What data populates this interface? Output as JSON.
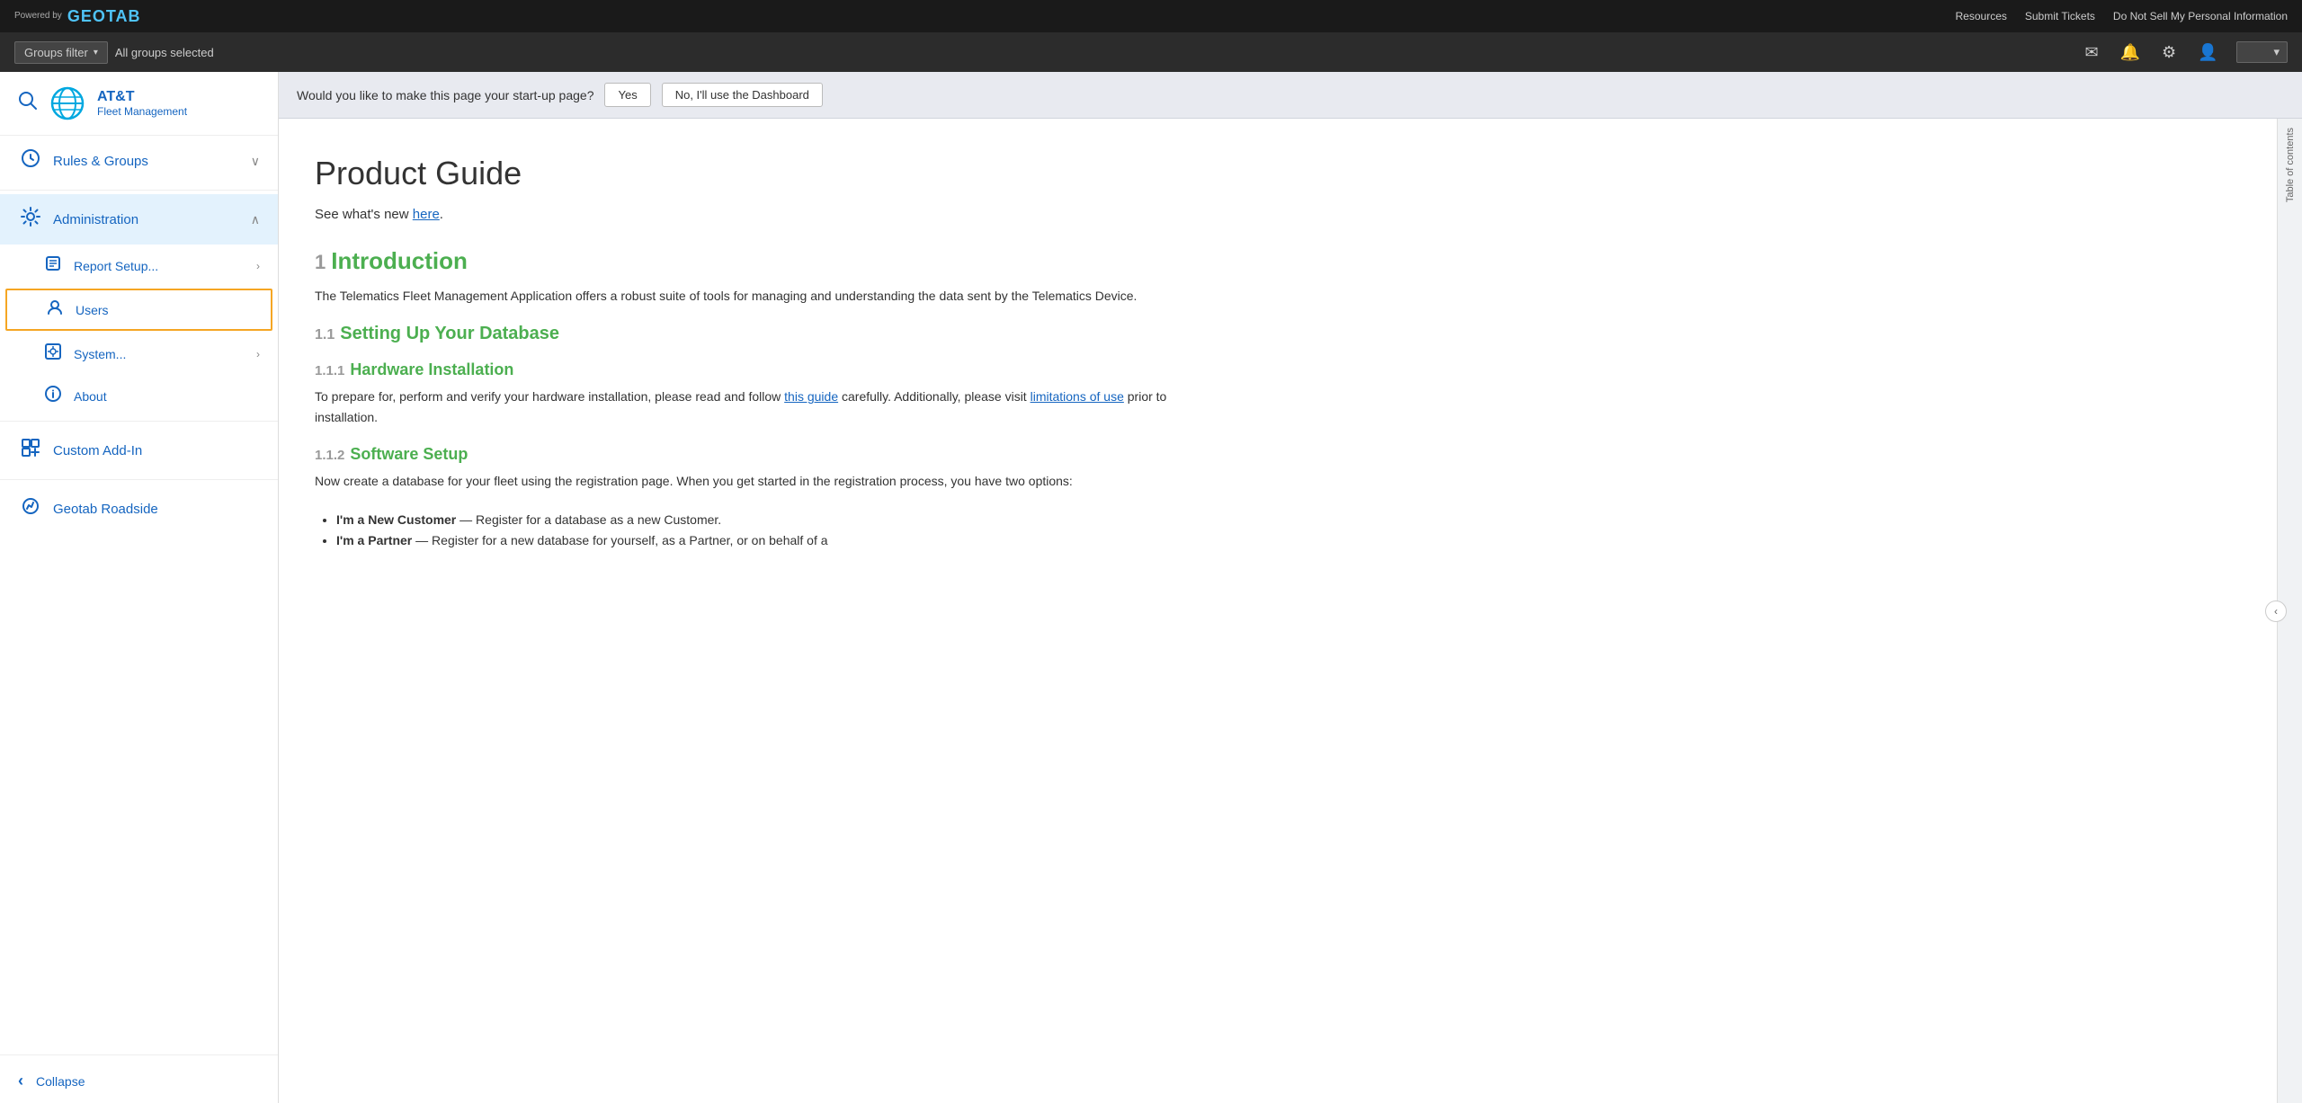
{
  "topbar": {
    "powered_by": "Powered\nby",
    "logo": "GEOTAB",
    "links": [
      "Resources",
      "Submit Tickets",
      "Do Not Sell My Personal Information"
    ]
  },
  "secondbar": {
    "groups_filter_label": "Groups filter",
    "groups_filter_arrow": "▾",
    "all_groups_text": "All groups selected",
    "icons": {
      "mail": "✉",
      "bell": "🔔",
      "gear": "⚙",
      "user": "👤"
    },
    "user_menu_arrow": "▾"
  },
  "sidebar": {
    "search_icon": "🔍",
    "brand_name": "AT&T",
    "brand_sub": "Fleet Management",
    "nav_items": [
      {
        "id": "rules-groups",
        "label": "Rules & Groups",
        "icon": "gear",
        "expandable": true,
        "expanded": false
      },
      {
        "id": "administration",
        "label": "Administration",
        "icon": "settings",
        "expandable": true,
        "expanded": true,
        "sub_items": [
          {
            "id": "report-setup",
            "label": "Report Setup...",
            "icon": "report",
            "has_arrow": true
          },
          {
            "id": "users",
            "label": "Users",
            "icon": "user",
            "selected": true
          },
          {
            "id": "system",
            "label": "System...",
            "icon": "system",
            "has_arrow": true
          },
          {
            "id": "about",
            "label": "About",
            "icon": "info"
          }
        ]
      },
      {
        "id": "custom-add-in",
        "label": "Custom Add-In",
        "icon": "puzzle"
      },
      {
        "id": "geotab-roadside",
        "label": "Geotab Roadside",
        "icon": "roadside"
      }
    ],
    "collapse_label": "Collapse",
    "collapse_icon": "‹"
  },
  "startup_bar": {
    "question": "Would you like to make this page your start-up page?",
    "yes_label": "Yes",
    "no_label": "No, I'll use the Dashboard"
  },
  "doc": {
    "title": "Product Guide",
    "subtitle_prefix": "See what's new ",
    "subtitle_link": "here",
    "subtitle_suffix": ".",
    "sections": [
      {
        "num": "1",
        "title": "Introduction",
        "body": "The Telematics Fleet Management Application offers a robust suite of tools for managing and understanding the data sent by the Telematics Device.",
        "subsections": [
          {
            "num": "1.1",
            "title": "Setting Up Your Database",
            "subsubsections": [
              {
                "num": "1.1.1",
                "title": "Hardware Installation",
                "body_prefix": "To prepare for, perform and verify your hardware installation, please read and follow ",
                "link1": "this guide",
                "body_middle": " carefully. Additionally, please visit ",
                "link2": "limitations of use",
                "body_suffix": " prior to installation."
              },
              {
                "num": "1.1.2",
                "title": "Software Setup",
                "body": "Now create a database for your fleet using the registration page. When you get started in the registration process, you have two options:",
                "bullets": [
                  {
                    "bold": "I'm a New Customer",
                    "text": " — Register for a database as a new Customer."
                  },
                  {
                    "bold": "I'm a Partner",
                    "text": " — Register for a new database for yourself, as a Partner, or on behalf of a"
                  }
                ]
              }
            ]
          }
        ]
      }
    ]
  },
  "toc": {
    "label": "Table of contents",
    "collapse_arrow": "‹"
  }
}
